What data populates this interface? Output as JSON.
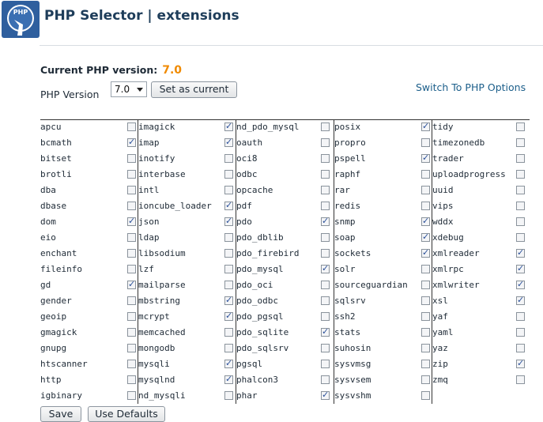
{
  "header": {
    "title": "PHP Selector | extensions",
    "logo_icon": "php-stopwatch-icon",
    "logo_text": "PHP"
  },
  "current": {
    "label": "Current PHP version:",
    "value": "7.0"
  },
  "version": {
    "label": "PHP Version",
    "selected": "7.0"
  },
  "buttons": {
    "set_current": "Set as current",
    "save": "Save",
    "use_defaults": "Use Defaults"
  },
  "switch_link": "Switch To PHP Options",
  "columns": [
    [
      {
        "n": "apcu",
        "c": false
      },
      {
        "n": "bcmath",
        "c": true
      },
      {
        "n": "bitset",
        "c": false
      },
      {
        "n": "brotli",
        "c": false
      },
      {
        "n": "dba",
        "c": false
      },
      {
        "n": "dbase",
        "c": false
      },
      {
        "n": "dom",
        "c": true
      },
      {
        "n": "eio",
        "c": false
      },
      {
        "n": "enchant",
        "c": false
      },
      {
        "n": "fileinfo",
        "c": false
      },
      {
        "n": "gd",
        "c": true
      },
      {
        "n": "gender",
        "c": false
      },
      {
        "n": "geoip",
        "c": false
      },
      {
        "n": "gmagick",
        "c": false
      },
      {
        "n": "gnupg",
        "c": false
      },
      {
        "n": "htscanner",
        "c": false
      },
      {
        "n": "http",
        "c": false
      },
      {
        "n": "igbinary",
        "c": false
      }
    ],
    [
      {
        "n": "imagick",
        "c": true
      },
      {
        "n": "imap",
        "c": true
      },
      {
        "n": "inotify",
        "c": false
      },
      {
        "n": "interbase",
        "c": false
      },
      {
        "n": "intl",
        "c": false
      },
      {
        "n": "ioncube_loader",
        "c": true
      },
      {
        "n": "json",
        "c": true
      },
      {
        "n": "ldap",
        "c": false
      },
      {
        "n": "libsodium",
        "c": false
      },
      {
        "n": "lzf",
        "c": false
      },
      {
        "n": "mailparse",
        "c": false
      },
      {
        "n": "mbstring",
        "c": true
      },
      {
        "n": "mcrypt",
        "c": true
      },
      {
        "n": "memcached",
        "c": false
      },
      {
        "n": "mongodb",
        "c": false
      },
      {
        "n": "mysqli",
        "c": true
      },
      {
        "n": "mysqlnd",
        "c": true
      },
      {
        "n": "nd_mysqli",
        "c": false
      }
    ],
    [
      {
        "n": "nd_pdo_mysql",
        "c": false
      },
      {
        "n": "oauth",
        "c": false
      },
      {
        "n": "oci8",
        "c": false
      },
      {
        "n": "odbc",
        "c": false
      },
      {
        "n": "opcache",
        "c": false
      },
      {
        "n": "pdf",
        "c": false
      },
      {
        "n": "pdo",
        "c": true
      },
      {
        "n": "pdo_dblib",
        "c": false
      },
      {
        "n": "pdo_firebird",
        "c": false
      },
      {
        "n": "pdo_mysql",
        "c": true
      },
      {
        "n": "pdo_oci",
        "c": false
      },
      {
        "n": "pdo_odbc",
        "c": false
      },
      {
        "n": "pdo_pgsql",
        "c": false
      },
      {
        "n": "pdo_sqlite",
        "c": true
      },
      {
        "n": "pdo_sqlsrv",
        "c": false
      },
      {
        "n": "pgsql",
        "c": false
      },
      {
        "n": "phalcon3",
        "c": false
      },
      {
        "n": "phar",
        "c": true
      }
    ],
    [
      {
        "n": "posix",
        "c": true
      },
      {
        "n": "propro",
        "c": false
      },
      {
        "n": "pspell",
        "c": true
      },
      {
        "n": "raphf",
        "c": false
      },
      {
        "n": "rar",
        "c": false
      },
      {
        "n": "redis",
        "c": false
      },
      {
        "n": "snmp",
        "c": true
      },
      {
        "n": "soap",
        "c": true
      },
      {
        "n": "sockets",
        "c": true
      },
      {
        "n": "solr",
        "c": false
      },
      {
        "n": "sourceguardian",
        "c": false
      },
      {
        "n": "sqlsrv",
        "c": false
      },
      {
        "n": "ssh2",
        "c": false
      },
      {
        "n": "stats",
        "c": false
      },
      {
        "n": "suhosin",
        "c": false
      },
      {
        "n": "sysvmsg",
        "c": false
      },
      {
        "n": "sysvsem",
        "c": false
      },
      {
        "n": "sysvshm",
        "c": false
      }
    ],
    [
      {
        "n": "tidy",
        "c": false
      },
      {
        "n": "timezonedb",
        "c": false
      },
      {
        "n": "trader",
        "c": false
      },
      {
        "n": "uploadprogress",
        "c": false
      },
      {
        "n": "uuid",
        "c": false
      },
      {
        "n": "vips",
        "c": false
      },
      {
        "n": "wddx",
        "c": false
      },
      {
        "n": "xdebug",
        "c": false
      },
      {
        "n": "xmlreader",
        "c": true
      },
      {
        "n": "xmlrpc",
        "c": true
      },
      {
        "n": "xmlwriter",
        "c": true
      },
      {
        "n": "xsl",
        "c": true
      },
      {
        "n": "yaf",
        "c": false
      },
      {
        "n": "yaml",
        "c": false
      },
      {
        "n": "yaz",
        "c": false
      },
      {
        "n": "zip",
        "c": true
      },
      {
        "n": "zmq",
        "c": false
      }
    ]
  ]
}
